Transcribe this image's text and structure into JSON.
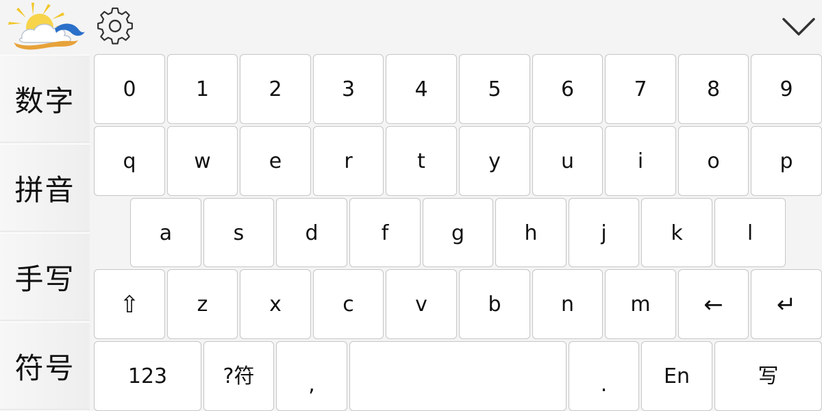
{
  "topbar": {
    "logo_icon": "sun-cloud-logo-icon",
    "settings_icon": "gear-icon",
    "collapse_icon": "chevron-down-icon"
  },
  "sidebar": {
    "items": [
      {
        "label": "数字"
      },
      {
        "label": "拼音"
      },
      {
        "label": "手写"
      },
      {
        "label": "符号"
      }
    ]
  },
  "keyboard": {
    "row_numbers": [
      "0",
      "1",
      "2",
      "3",
      "4",
      "5",
      "6",
      "7",
      "8",
      "9"
    ],
    "row_q": [
      "q",
      "w",
      "e",
      "r",
      "t",
      "y",
      "u",
      "i",
      "o",
      "p"
    ],
    "row_a": [
      "a",
      "s",
      "d",
      "f",
      "g",
      "h",
      "j",
      "k",
      "l"
    ],
    "row_z": {
      "shift": "⇧",
      "letters": [
        "z",
        "x",
        "c",
        "v",
        "b",
        "n",
        "m"
      ],
      "backspace": "←",
      "enter": "↵"
    },
    "row_bottom": {
      "num_mode": "123",
      "symbol_mode": "?符",
      "comma": ",",
      "space": "",
      "period": ".",
      "lang": "En",
      "handwrite": "写"
    }
  },
  "colors": {
    "background": "#f4f4f4",
    "key_face": "#ffffff",
    "key_border": "#c6c6c6"
  }
}
